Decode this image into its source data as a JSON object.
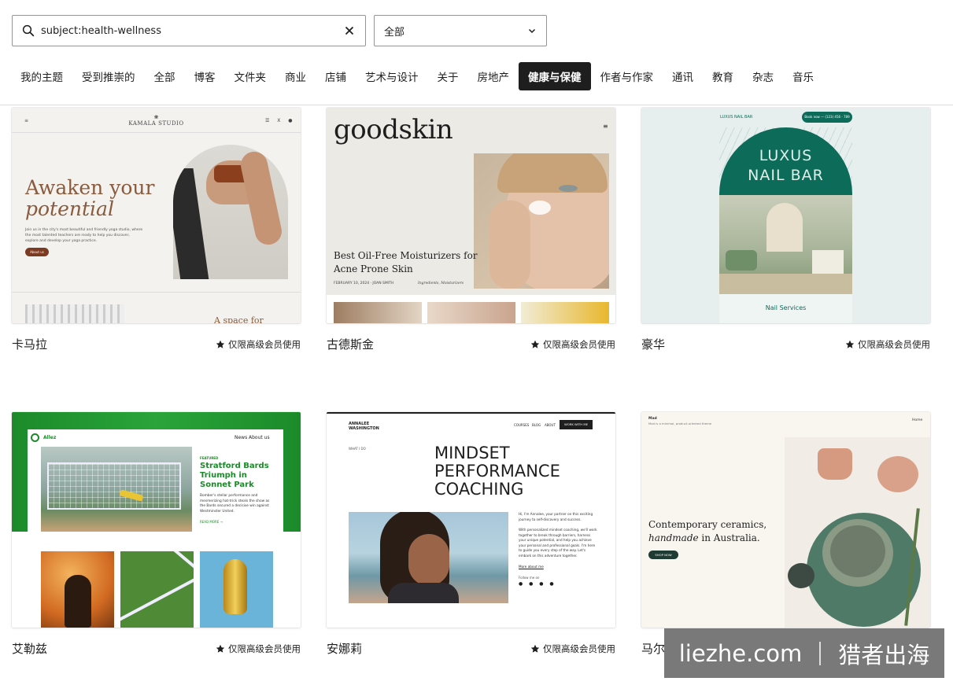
{
  "search": {
    "value": "subject:health-wellness"
  },
  "category_select": {
    "value": "全部"
  },
  "tabs": [
    {
      "label": "我的主题"
    },
    {
      "label": "受到推崇的"
    },
    {
      "label": "全部"
    },
    {
      "label": "博客"
    },
    {
      "label": "文件夹"
    },
    {
      "label": "商业"
    },
    {
      "label": "店铺"
    },
    {
      "label": "艺术与设计"
    },
    {
      "label": "关于"
    },
    {
      "label": "房地产"
    },
    {
      "label": "健康与保健"
    },
    {
      "label": "作者与作家"
    },
    {
      "label": "通讯"
    },
    {
      "label": "教育"
    },
    {
      "label": "杂志"
    },
    {
      "label": "音乐"
    }
  ],
  "active_tab": "健康与保健",
  "premium_label": "仅限高级会员使用",
  "themes": [
    {
      "name": "卡马拉",
      "preview": {
        "brand": "KAMALA STUDIO",
        "heading_1": "Awaken your",
        "heading_2": "potential",
        "body": "Join us in the city's most beautiful and friendly yoga studio, where the most talented teachers are ready to help you discover, explore and develop your yoga practice.",
        "button": "About us",
        "next_heading": "A space for"
      }
    },
    {
      "name": "古德斯金",
      "preview": {
        "brand": "goodskin",
        "post_title_1": "Best Oil-Free Moisturizers for",
        "post_title_2": "Acne Prone Skin",
        "post_meta": "FEBRUARY 10, 2024 · JOAN SMITH",
        "post_tags": "Ingredients, Moisturizers"
      }
    },
    {
      "name": "豪华",
      "preview": {
        "brand": "LUXUS NAIL BAR",
        "book": "Book now — (123) 456 - 789",
        "title_1": "LUXUS",
        "title_2": "NAIL BAR",
        "services": "Nail Services"
      }
    },
    {
      "name": "艾勒兹",
      "preview": {
        "brand": "Allez",
        "nav_1": "News",
        "nav_2": "About us",
        "featured": "FEATURED",
        "headline_1": "Stratford Bards",
        "headline_2": "Triumph in",
        "headline_3": "Sonnet Park",
        "body": "Bomber's stellar performance and mesmerizing hat-trick steals the show as the Bards secured a decisive win against Westminster United.",
        "read_more": "READ MORE →"
      }
    },
    {
      "name": "安娜莉",
      "preview": {
        "brand_1": "ANNALEE",
        "brand_2": "WASHINGTON",
        "nav": [
          "COURSES",
          "BLOG",
          "ABOUT"
        ],
        "cta": "WORK WITH ME",
        "kicker": "WHAT I DO",
        "title_1": "MINDSET",
        "title_2": "PERFORMANCE",
        "title_3": "COACHING",
        "body_1": "Hi, I'm Annalee, your partner on this exciting journey to self-discovery and success.",
        "body_2": "With personalized mindset coaching, we'll work together to break through barriers, harness your unique potential, and help you achieve your personal and professional goals. I'm here to guide you every step of the way. Let's embark on this adventure together.",
        "link": "More about me",
        "social": "Follow me on"
      }
    },
    {
      "name": "马尔",
      "preview": {
        "brand": "Mad",
        "tagline": "Mad is a minimal, product-oriented theme",
        "nav": "Home",
        "headline_1": "Contemporary ceramics,",
        "headline_2_italic": "handmade",
        "headline_2_rest": " in Australia.",
        "button": "SHOP NOW"
      }
    }
  ],
  "watermark": {
    "site": "liezhe.com",
    "name": "猎者出海"
  },
  "colors": {
    "accent_dark": "#1e1e1e",
    "kamala_brown": "#7a3b22",
    "luxus_green": "#0d6b5a",
    "allez_green": "#1c8a2a",
    "mad_button": "#1f3b33"
  }
}
